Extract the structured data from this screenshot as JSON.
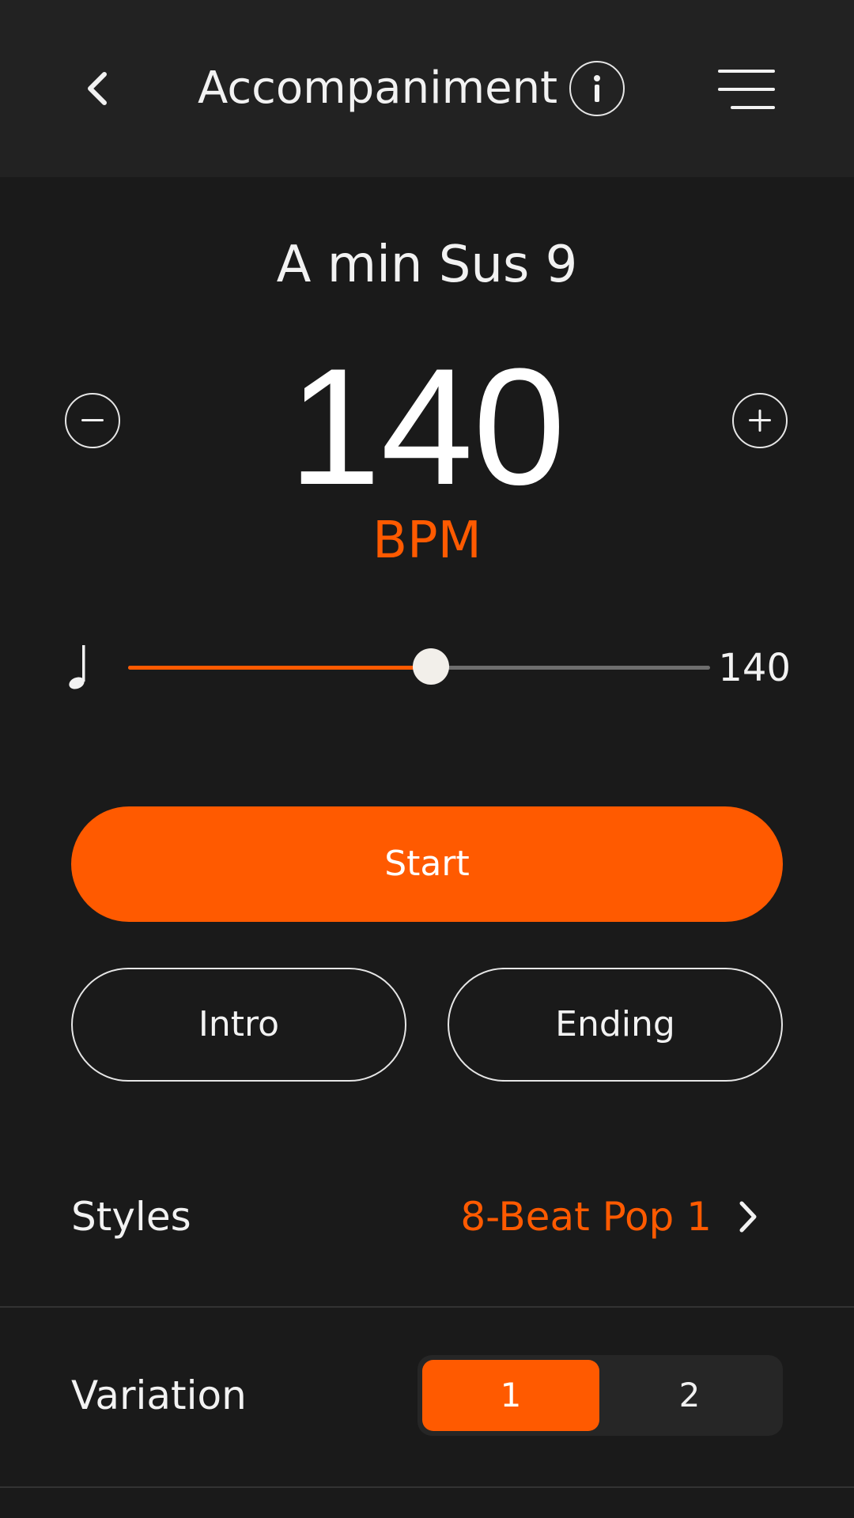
{
  "header": {
    "title": "Accompaniment",
    "icons": {
      "back": "chevron-left-icon",
      "info": "info-icon",
      "menu": "hamburger-menu-icon"
    }
  },
  "chord": {
    "name": "A min Sus 9"
  },
  "tempo": {
    "value": "140",
    "unit": "BPM",
    "slider_value": "140",
    "slider_level": 0.52,
    "icons": {
      "decrease": "minus-icon",
      "increase": "plus-icon",
      "note": "quarter-note-icon"
    }
  },
  "actions": {
    "start": "Start",
    "intro": "Intro",
    "ending": "Ending"
  },
  "styles": {
    "label": "Styles",
    "value": "8-Beat Pop 1",
    "icon": "chevron-right-icon"
  },
  "variation": {
    "label": "Variation",
    "options": [
      "1",
      "2"
    ],
    "selected": "1"
  },
  "colors": {
    "accent": "#ff5a00",
    "background": "#1a1a1a",
    "header": "#222222",
    "text": "#f2f2f2"
  }
}
